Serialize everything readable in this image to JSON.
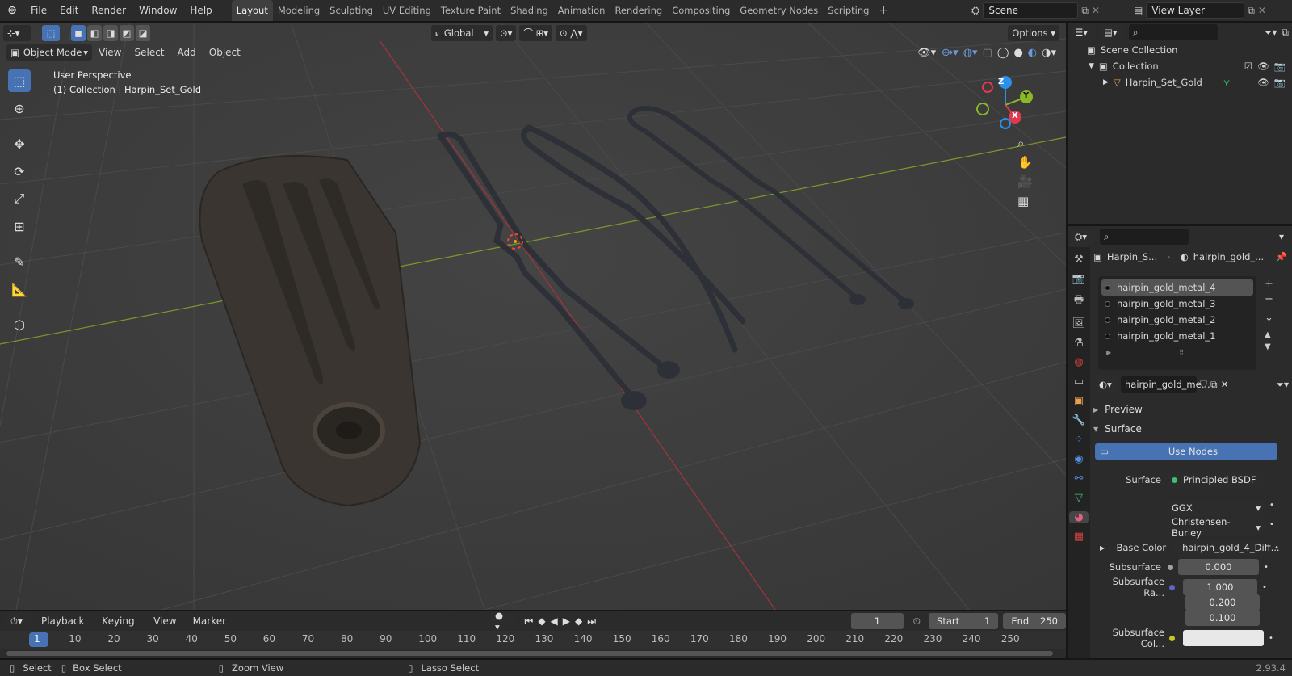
{
  "menubar": {
    "menus": [
      "File",
      "Edit",
      "Render",
      "Window",
      "Help"
    ],
    "workspaces": [
      "Layout",
      "Modeling",
      "Sculpting",
      "UV Editing",
      "Texture Paint",
      "Shading",
      "Animation",
      "Rendering",
      "Compositing",
      "Geometry Nodes",
      "Scripting"
    ],
    "active_workspace": "Layout",
    "scene": "Scene",
    "view_layer": "View Layer"
  },
  "viewport": {
    "mode": "Object Mode",
    "menus": [
      "View",
      "Select",
      "Add",
      "Object"
    ],
    "orientation": "Global",
    "options_label": "Options",
    "info_line1": "User Perspective",
    "info_line2": "(1) Collection | Harpin_Set_Gold",
    "gizmo_axes": {
      "x": "X",
      "y": "Y",
      "z": "Z"
    }
  },
  "outliner": {
    "root": "Scene Collection",
    "collection": "Collection",
    "object": "Harpin_Set_Gold"
  },
  "properties": {
    "breadcrumb_object": "Harpin_S...",
    "breadcrumb_material": "hairpin_gold_...",
    "material_slots": [
      "hairpin_gold_metal_4",
      "hairpin_gold_metal_3",
      "hairpin_gold_metal_2",
      "hairpin_gold_metal_1"
    ],
    "selected_slot": 0,
    "material_name": "hairpin_gold_me...",
    "preview_label": "Preview",
    "surface_section": "Surface",
    "use_nodes_label": "Use Nodes",
    "surface_label": "Surface",
    "surface_value": "Principled BSDF",
    "distribution": "GGX",
    "subsurface_method": "Christensen-Burley",
    "base_color_label": "Base Color",
    "base_color_value": "hairpin_gold_4_Diff...",
    "subsurface_label": "Subsurface",
    "subsurface_value": "0.000",
    "subsurface_radius_label": "Subsurface Ra...",
    "subsurface_radius": [
      "1.000",
      "0.200",
      "0.100"
    ],
    "subsurface_color_label": "Subsurface Col..."
  },
  "timeline": {
    "menus": [
      "Playback",
      "Keying",
      "View",
      "Marker"
    ],
    "current_frame": "1",
    "start_label": "Start",
    "start": "1",
    "end_label": "End",
    "end": "250",
    "ticks": [
      "1",
      "10",
      "20",
      "30",
      "40",
      "50",
      "60",
      "70",
      "80",
      "90",
      "100",
      "110",
      "120",
      "130",
      "140",
      "150",
      "160",
      "170",
      "180",
      "190",
      "200",
      "210",
      "220",
      "230",
      "240",
      "250"
    ]
  },
  "statusbar": {
    "select": "Select",
    "box_select": "Box Select",
    "zoom_view": "Zoom View",
    "lasso_select": "Lasso Select",
    "version": "2.93.4"
  },
  "colors": {
    "accent": "#4772b3",
    "x_axis": "#e0394f",
    "y_axis": "#8ab826",
    "z_axis": "#2c8fea"
  }
}
